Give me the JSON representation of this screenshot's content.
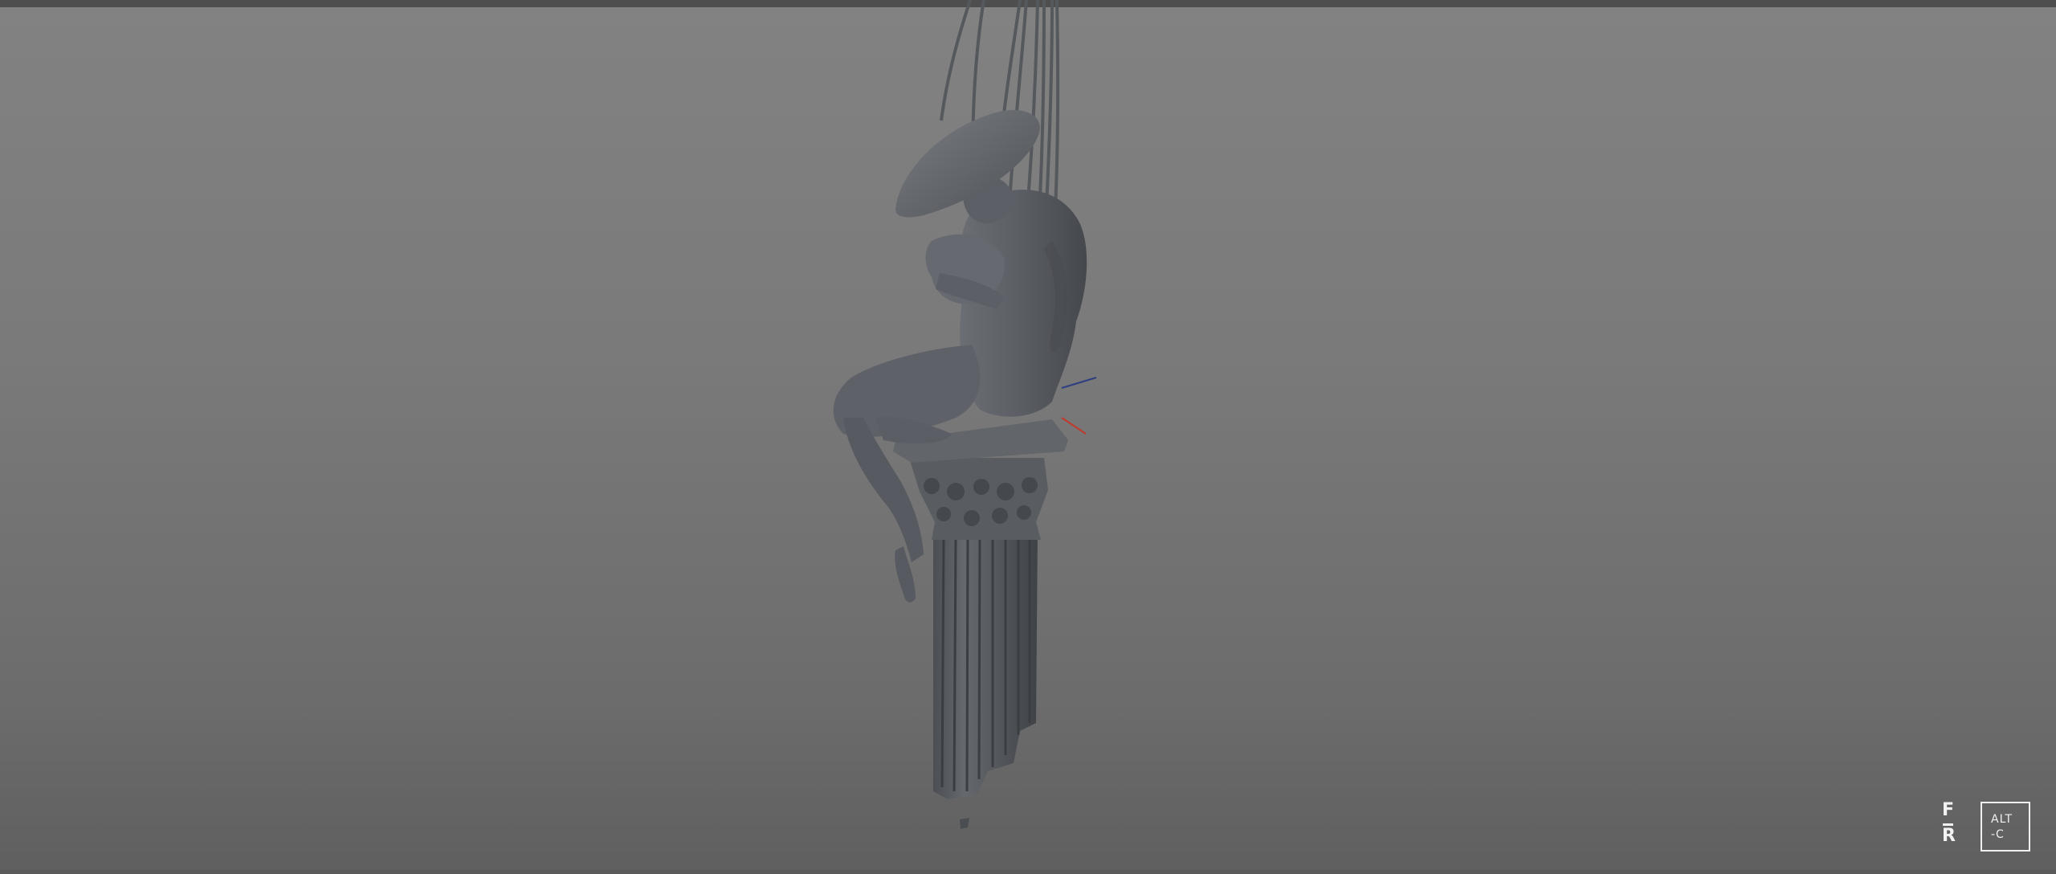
{
  "viewport": {
    "background_top": "#828282",
    "background_bottom": "#5f5f5f",
    "model_color": "#5c5f64"
  },
  "scene": {
    "object": "sculpture-figure-seated-on-corinthian-column",
    "axis_colors": {
      "x": "#c0392b",
      "y": "#2c3e80"
    }
  },
  "logos": {
    "fr_top": "F",
    "fr_bottom": "R",
    "altc_line1": "ALT",
    "altc_line2": "-C"
  }
}
